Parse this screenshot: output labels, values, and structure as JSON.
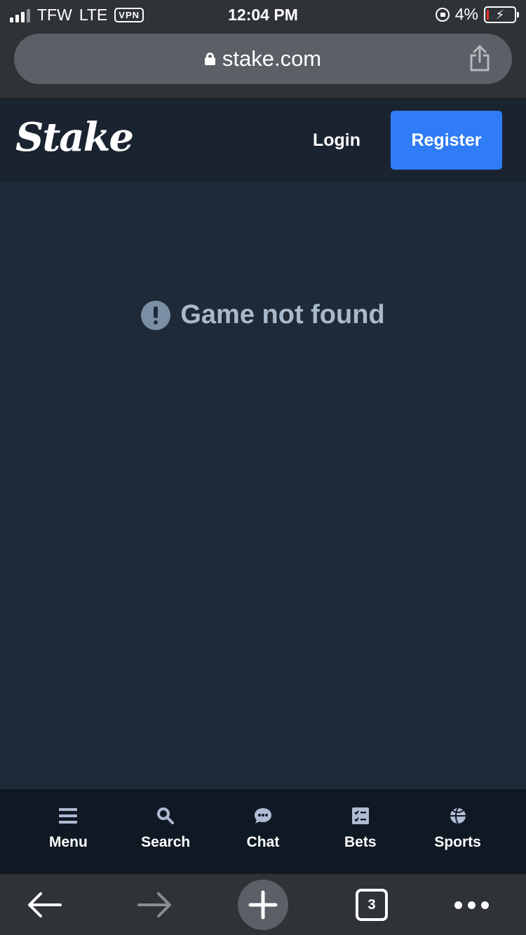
{
  "status_bar": {
    "carrier": "TFW",
    "network": "LTE",
    "vpn": "VPN",
    "time": "12:04 PM",
    "battery": "4%"
  },
  "browser": {
    "url": "stake.com",
    "tabs_count": "3"
  },
  "header": {
    "logo": "Stake",
    "login_label": "Login",
    "register_label": "Register",
    "register_color": "#2f7cf6"
  },
  "main": {
    "message": "Game not found"
  },
  "bottom_nav": {
    "items": [
      {
        "label": "Menu",
        "icon": "menu-icon"
      },
      {
        "label": "Search",
        "icon": "search-icon"
      },
      {
        "label": "Chat",
        "icon": "chat-icon"
      },
      {
        "label": "Bets",
        "icon": "bets-icon"
      },
      {
        "label": "Sports",
        "icon": "sports-icon"
      }
    ]
  }
}
